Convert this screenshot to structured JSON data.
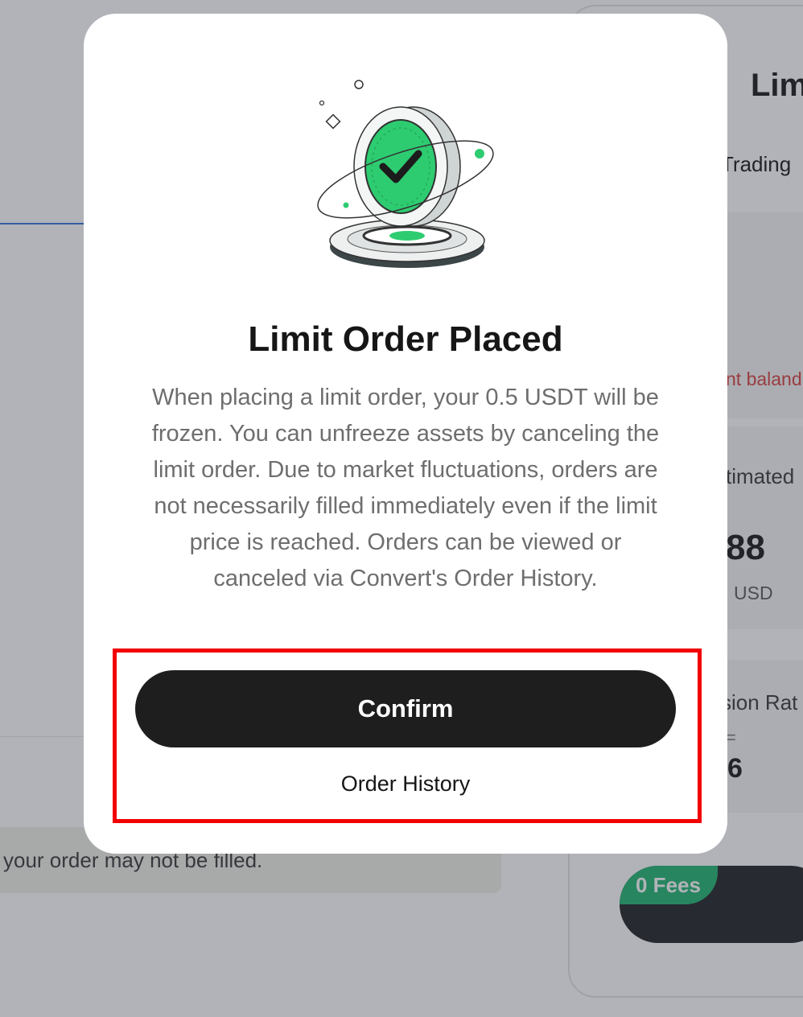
{
  "background": {
    "right_panel": {
      "title_partial": "Lim",
      "tab_partial": "Trading",
      "balance_warning_partial": "nt baland",
      "estimated_label_partial": "timated",
      "amount_partial": "88",
      "currency": "USD",
      "rate_label_partial": "sion Rat",
      "rate_equals": "=",
      "rate_value_partial": "6",
      "fees_badge": "0 Fees"
    },
    "notice_text": "your order may not be filled."
  },
  "modal": {
    "title": "Limit Order Placed",
    "body": "When placing a limit order, your 0.5 USDT will be frozen. You can unfreeze assets by canceling the limit order. Due to market fluctuations, orders are not necessarily filled immediately even if the limit price is reached. Orders can be viewed or canceled via Convert's Order History.",
    "confirm_label": "Confirm",
    "order_history_label": "Order History",
    "illustration_icon": "success-coin-checkmark-icon"
  },
  "colors": {
    "accent_green": "#2ecc71",
    "button_dark": "#1e1e1e",
    "highlight_red": "#f20000",
    "warning_red": "#d8393a"
  }
}
